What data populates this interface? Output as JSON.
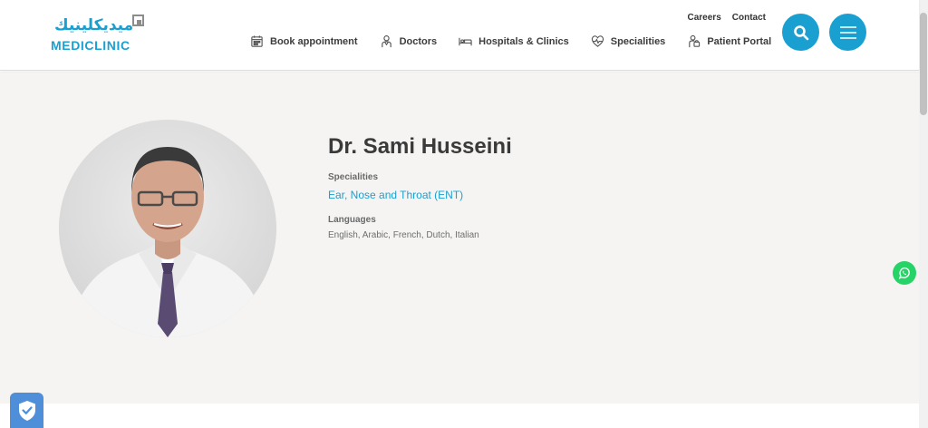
{
  "brand": {
    "arabic_name": "ميديكلينيك",
    "name": "MEDICLINIC",
    "accent_color": "#1a9fd1"
  },
  "utility_links": [
    "Careers",
    "Contact"
  ],
  "nav": [
    {
      "label": "Book appointment",
      "icon": "calendar-icon"
    },
    {
      "label": "Doctors",
      "icon": "doctor-icon"
    },
    {
      "label": "Hospitals & Clinics",
      "icon": "hospital-bed-icon"
    },
    {
      "label": "Specialities",
      "icon": "heart-pulse-icon"
    },
    {
      "label": "Patient Portal",
      "icon": "patient-portal-icon"
    }
  ],
  "header_buttons": [
    "search-icon",
    "hamburger-menu-icon"
  ],
  "profile": {
    "name": "Dr. Sami Husseini",
    "specialities_label": "Specialities",
    "speciality": "Ear, Nose and Throat (ENT)",
    "languages_label": "Languages",
    "languages": "English, Arabic, French, Dutch, Italian"
  },
  "floating": {
    "whatsapp": "whatsapp-icon",
    "privacy": "shield-check-icon"
  }
}
